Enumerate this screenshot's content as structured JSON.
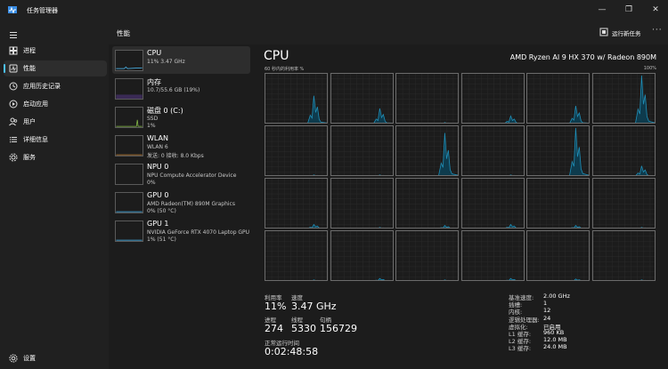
{
  "app": {
    "title": "任务管理器"
  },
  "nav": {
    "items": [
      {
        "label": "进程",
        "icon": "processes-icon"
      },
      {
        "label": "性能",
        "icon": "performance-icon",
        "active": true
      },
      {
        "label": "应用历史记录",
        "icon": "app-history-icon"
      },
      {
        "label": "启动应用",
        "icon": "startup-icon"
      },
      {
        "label": "用户",
        "icon": "users-icon"
      },
      {
        "label": "详细信息",
        "icon": "details-icon"
      },
      {
        "label": "服务",
        "icon": "services-icon"
      }
    ],
    "settings": "设置"
  },
  "header": {
    "title": "性能",
    "run_task": "运行新任务",
    "more": "···"
  },
  "devices": [
    {
      "name": "CPU",
      "sub": "11% 3.47 GHz",
      "sub2": ""
    },
    {
      "name": "内存",
      "sub": "10.7/55.6 GB (19%)",
      "sub2": ""
    },
    {
      "name": "磁盘 0 (C:)",
      "sub": "SSD",
      "sub2": "1%"
    },
    {
      "name": "WLAN",
      "sub": "WLAN 6",
      "sub2": "发送: 0 接收: 8.0 Kbps"
    },
    {
      "name": "NPU 0",
      "sub": "NPU Compute Accelerator Device",
      "sub2": "0%"
    },
    {
      "name": "GPU 0",
      "sub": "AMD Radeon(TM) 890M Graphics",
      "sub2": "0% (50 °C)"
    },
    {
      "name": "GPU 1",
      "sub": "NVIDIA GeForce RTX 4070 Laptop GPU",
      "sub2": "1% (51 °C)"
    }
  ],
  "cpu": {
    "title": "CPU",
    "model": "AMD Ryzen AI 9 HX 370 w/ Radeon 890M",
    "axis_left": "60 秒内的利用率 %",
    "axis_right": "100%",
    "stats": {
      "util_label": "利用率",
      "util": "11%",
      "speed_label": "速度",
      "speed": "3.47 GHz",
      "proc_label": "进程",
      "proc": "274",
      "thread_label": "线程",
      "thread": "5330",
      "handle_label": "句柄",
      "handle": "156729",
      "uptime_label": "正常运行时间",
      "uptime": "0:02:48:58"
    },
    "details": [
      {
        "k": "基准速度:",
        "v": "2.00 GHz"
      },
      {
        "k": "插槽:",
        "v": "1"
      },
      {
        "k": "内核:",
        "v": "12"
      },
      {
        "k": "逻辑处理器:",
        "v": "24"
      },
      {
        "k": "虚拟化:",
        "v": "已启用"
      },
      {
        "k": "L1 缓存:",
        "v": "960 KB"
      },
      {
        "k": "L2 缓存:",
        "v": "12.0 MB"
      },
      {
        "k": "L3 缓存:",
        "v": "24.0 MB"
      }
    ]
  },
  "colors": {
    "accent": "#4cc2ff",
    "graph_line": "#1e8fb8",
    "graph_fill": "#0e3b4d",
    "border": "#6b6b6b"
  }
}
